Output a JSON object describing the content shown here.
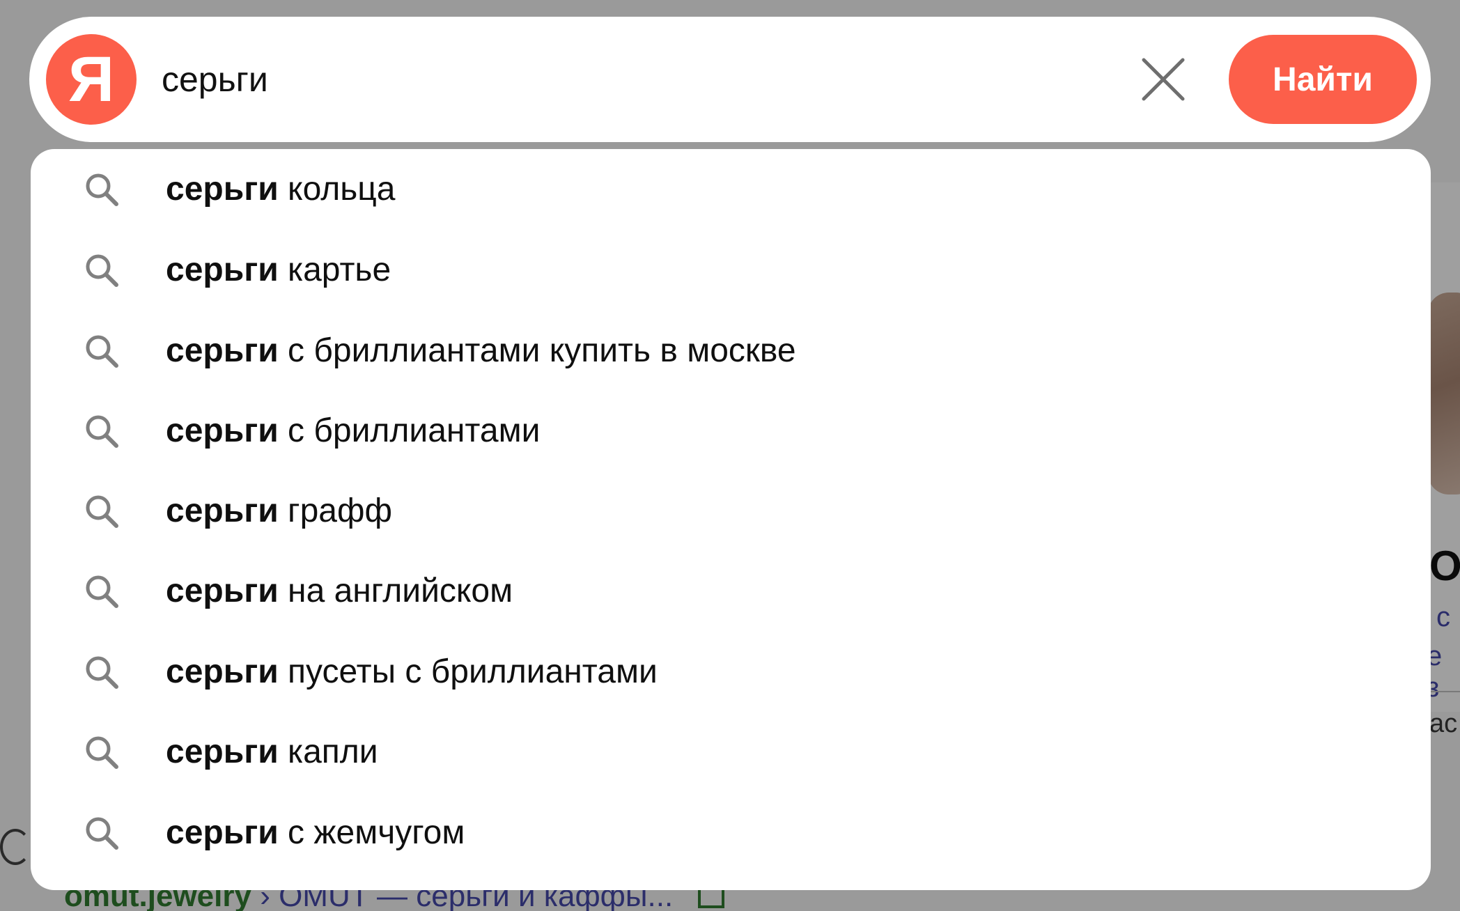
{
  "search": {
    "logo_letter": "Я",
    "query": "серьги",
    "clear_icon": "close-icon",
    "find_label": "Найти",
    "accent_color": "#fc5f4a"
  },
  "suggestions": {
    "icon": "search-icon",
    "items": [
      {
        "bold": "серьги",
        "rest": " кольца"
      },
      {
        "bold": "серьги",
        "rest": " картье"
      },
      {
        "bold": "серьги",
        "rest": " с бриллиантами купить в москве"
      },
      {
        "bold": "серьги",
        "rest": " с бриллиантами"
      },
      {
        "bold": "серьги",
        "rest": " графф"
      },
      {
        "bold": "серьги",
        "rest": " на английском"
      },
      {
        "bold": "серьги",
        "rest": " пусеты с бриллиантами"
      },
      {
        "bold": "серьги",
        "rest": " капли"
      },
      {
        "bold": "серьги",
        "rest": " с жемчугом"
      }
    ]
  },
  "background": {
    "card_big_text": "О",
    "card_link_1": "с",
    "card_link_2": "е з",
    "card_tag": "ас",
    "result_site": "omut.jewelry",
    "result_crumb": "› OMUT — серьги и каффы..."
  }
}
